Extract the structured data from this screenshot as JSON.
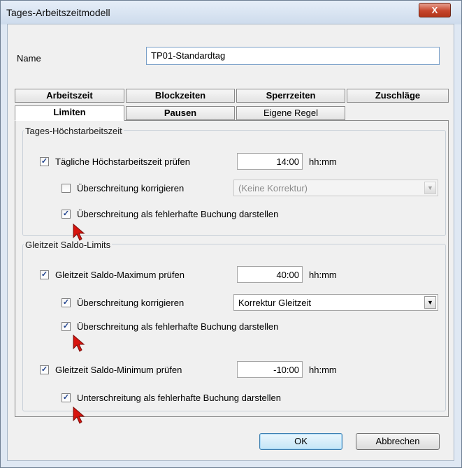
{
  "window": {
    "title": "Tages-Arbeitszeitmodell",
    "close_glyph": "X"
  },
  "name": {
    "label": "Name",
    "value": "TP01-Standardtag"
  },
  "tabs": {
    "row1": [
      "Arbeitszeit",
      "Blockzeiten",
      "Sperrzeiten",
      "Zuschläge"
    ],
    "row2": [
      "Limiten",
      "Pausen",
      "Eigene Regel"
    ],
    "active": "Limiten"
  },
  "group1": {
    "title": "Tages-Höchstarbeitszeit",
    "check_max": {
      "label": "Tägliche Höchstarbeitszeit prüfen",
      "checked": true,
      "value": "14:00",
      "unit": "hh:mm"
    },
    "check_correct": {
      "label": "Überschreitung korrigieren",
      "checked": false,
      "combo": "(Keine Korrektur)"
    },
    "check_error": {
      "label": "Überschreitung als fehlerhafte Buchung darstellen",
      "checked": true
    }
  },
  "group2": {
    "title": "Gleitzeit Saldo-Limits",
    "check_max": {
      "label": "Gleitzeit Saldo-Maximum prüfen",
      "checked": true,
      "value": "40:00",
      "unit": "hh:mm"
    },
    "check_correct": {
      "label": "Überschreitung korrigieren",
      "checked": true,
      "combo": "Korrektur Gleitzeit"
    },
    "check_error": {
      "label": "Überschreitung als fehlerhafte Buchung darstellen",
      "checked": true
    },
    "check_min": {
      "label": "Gleitzeit Saldo-Minimum prüfen",
      "checked": true,
      "value": "-10:00",
      "unit": "hh:mm"
    },
    "check_under": {
      "label": "Unterschreitung als fehlerhafte Buchung darstellen",
      "checked": true
    }
  },
  "buttons": {
    "ok": "OK",
    "cancel": "Abbrechen"
  },
  "glyphs": {
    "check": "✓",
    "dropdown": "▼"
  },
  "colors": {
    "cursor": "#d8140e",
    "accent": "#3c7fb1"
  }
}
